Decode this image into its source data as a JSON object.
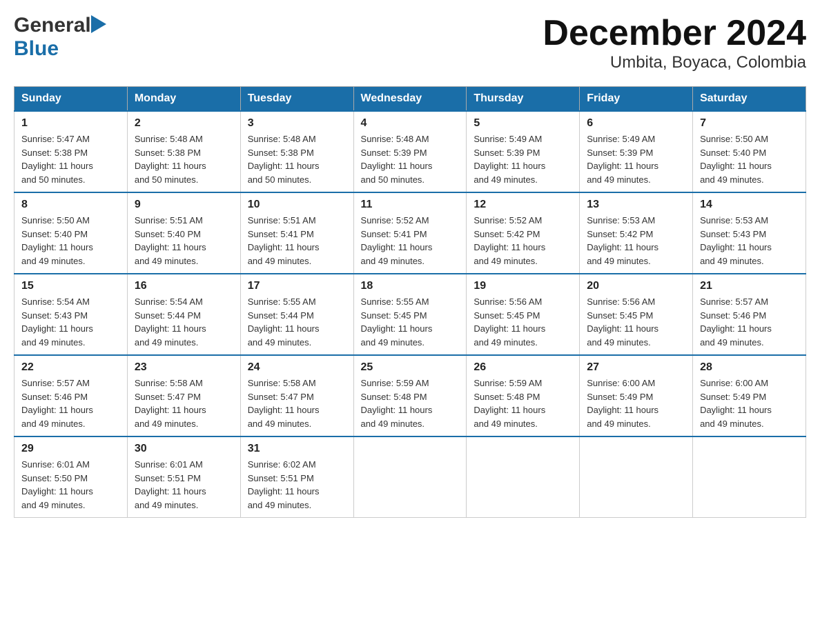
{
  "header": {
    "logo_general": "General",
    "logo_blue": "Blue",
    "title": "December 2024",
    "subtitle": "Umbita, Boyaca, Colombia"
  },
  "weekdays": [
    "Sunday",
    "Monday",
    "Tuesday",
    "Wednesday",
    "Thursday",
    "Friday",
    "Saturday"
  ],
  "weeks": [
    [
      {
        "day": "1",
        "sunrise": "5:47 AM",
        "sunset": "5:38 PM",
        "daylight": "11 hours and 50 minutes."
      },
      {
        "day": "2",
        "sunrise": "5:48 AM",
        "sunset": "5:38 PM",
        "daylight": "11 hours and 50 minutes."
      },
      {
        "day": "3",
        "sunrise": "5:48 AM",
        "sunset": "5:38 PM",
        "daylight": "11 hours and 50 minutes."
      },
      {
        "day": "4",
        "sunrise": "5:48 AM",
        "sunset": "5:39 PM",
        "daylight": "11 hours and 50 minutes."
      },
      {
        "day": "5",
        "sunrise": "5:49 AM",
        "sunset": "5:39 PM",
        "daylight": "11 hours and 49 minutes."
      },
      {
        "day": "6",
        "sunrise": "5:49 AM",
        "sunset": "5:39 PM",
        "daylight": "11 hours and 49 minutes."
      },
      {
        "day": "7",
        "sunrise": "5:50 AM",
        "sunset": "5:40 PM",
        "daylight": "11 hours and 49 minutes."
      }
    ],
    [
      {
        "day": "8",
        "sunrise": "5:50 AM",
        "sunset": "5:40 PM",
        "daylight": "11 hours and 49 minutes."
      },
      {
        "day": "9",
        "sunrise": "5:51 AM",
        "sunset": "5:40 PM",
        "daylight": "11 hours and 49 minutes."
      },
      {
        "day": "10",
        "sunrise": "5:51 AM",
        "sunset": "5:41 PM",
        "daylight": "11 hours and 49 minutes."
      },
      {
        "day": "11",
        "sunrise": "5:52 AM",
        "sunset": "5:41 PM",
        "daylight": "11 hours and 49 minutes."
      },
      {
        "day": "12",
        "sunrise": "5:52 AM",
        "sunset": "5:42 PM",
        "daylight": "11 hours and 49 minutes."
      },
      {
        "day": "13",
        "sunrise": "5:53 AM",
        "sunset": "5:42 PM",
        "daylight": "11 hours and 49 minutes."
      },
      {
        "day": "14",
        "sunrise": "5:53 AM",
        "sunset": "5:43 PM",
        "daylight": "11 hours and 49 minutes."
      }
    ],
    [
      {
        "day": "15",
        "sunrise": "5:54 AM",
        "sunset": "5:43 PM",
        "daylight": "11 hours and 49 minutes."
      },
      {
        "day": "16",
        "sunrise": "5:54 AM",
        "sunset": "5:44 PM",
        "daylight": "11 hours and 49 minutes."
      },
      {
        "day": "17",
        "sunrise": "5:55 AM",
        "sunset": "5:44 PM",
        "daylight": "11 hours and 49 minutes."
      },
      {
        "day": "18",
        "sunrise": "5:55 AM",
        "sunset": "5:45 PM",
        "daylight": "11 hours and 49 minutes."
      },
      {
        "day": "19",
        "sunrise": "5:56 AM",
        "sunset": "5:45 PM",
        "daylight": "11 hours and 49 minutes."
      },
      {
        "day": "20",
        "sunrise": "5:56 AM",
        "sunset": "5:45 PM",
        "daylight": "11 hours and 49 minutes."
      },
      {
        "day": "21",
        "sunrise": "5:57 AM",
        "sunset": "5:46 PM",
        "daylight": "11 hours and 49 minutes."
      }
    ],
    [
      {
        "day": "22",
        "sunrise": "5:57 AM",
        "sunset": "5:46 PM",
        "daylight": "11 hours and 49 minutes."
      },
      {
        "day": "23",
        "sunrise": "5:58 AM",
        "sunset": "5:47 PM",
        "daylight": "11 hours and 49 minutes."
      },
      {
        "day": "24",
        "sunrise": "5:58 AM",
        "sunset": "5:47 PM",
        "daylight": "11 hours and 49 minutes."
      },
      {
        "day": "25",
        "sunrise": "5:59 AM",
        "sunset": "5:48 PM",
        "daylight": "11 hours and 49 minutes."
      },
      {
        "day": "26",
        "sunrise": "5:59 AM",
        "sunset": "5:48 PM",
        "daylight": "11 hours and 49 minutes."
      },
      {
        "day": "27",
        "sunrise": "6:00 AM",
        "sunset": "5:49 PM",
        "daylight": "11 hours and 49 minutes."
      },
      {
        "day": "28",
        "sunrise": "6:00 AM",
        "sunset": "5:49 PM",
        "daylight": "11 hours and 49 minutes."
      }
    ],
    [
      {
        "day": "29",
        "sunrise": "6:01 AM",
        "sunset": "5:50 PM",
        "daylight": "11 hours and 49 minutes."
      },
      {
        "day": "30",
        "sunrise": "6:01 AM",
        "sunset": "5:51 PM",
        "daylight": "11 hours and 49 minutes."
      },
      {
        "day": "31",
        "sunrise": "6:02 AM",
        "sunset": "5:51 PM",
        "daylight": "11 hours and 49 minutes."
      },
      null,
      null,
      null,
      null
    ]
  ],
  "labels": {
    "sunrise": "Sunrise:",
    "sunset": "Sunset:",
    "daylight": "Daylight:"
  }
}
